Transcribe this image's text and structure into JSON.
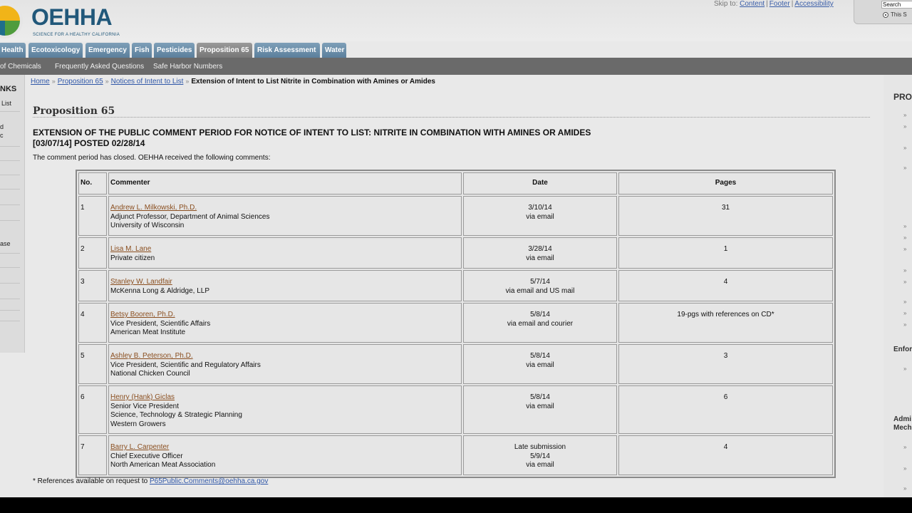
{
  "header": {
    "logo_text": "OEHHA",
    "logo_tagline": "SCIENCE FOR A HEALTHY CALIFORNIA",
    "skip_label": "Skip to:",
    "skip_links": [
      "Content",
      "Footer",
      "Accessibility"
    ],
    "search_placeholder": "Search",
    "search_scope_label": "This S"
  },
  "nav": {
    "tabs": [
      "Health",
      "Ecotoxicology",
      "Emergency",
      "Fish",
      "Pesticides",
      "Proposition 65",
      "Risk Assessment",
      "Water"
    ],
    "active_tab": "Proposition 65",
    "subnav": [
      "of Chemicals",
      "Frequently Asked Questions",
      "Safe Harbor Numbers"
    ]
  },
  "left_sidebar": {
    "title": "NKS",
    "items": [
      "List",
      "d",
      "c",
      "ase"
    ]
  },
  "right_sidebar": {
    "title": "PRO",
    "headings": [
      "Enfor",
      "Admi",
      "Mech"
    ]
  },
  "breadcrumb": {
    "links": [
      "Home",
      "Proposition 65",
      "Notices of Intent to List"
    ],
    "current": "Extension of Intent to List Nitrite in Combination with Amines or Amides"
  },
  "main": {
    "page_title": "Proposition 65",
    "heading_line1": "EXTENSION OF THE PUBLIC COMMENT PERIOD FOR NOTICE OF INTENT TO LIST: NITRITE IN COMBINATION WITH AMINES OR AMIDES",
    "heading_line2": "[03/07/14] POSTED 02/28/14",
    "intro": "The comment period has closed. OEHHA received the following comments:",
    "table": {
      "headers": [
        "No.",
        "Commenter",
        "Date",
        "Pages"
      ],
      "rows": [
        {
          "no": "1",
          "name": "Andrew L. Milkowski, Ph.D.",
          "details": [
            "Adjunct Professor, Department of Animal Sciences",
            "University of Wisconsin"
          ],
          "date": [
            "3/10/14",
            "via email"
          ],
          "pages": "31"
        },
        {
          "no": "2",
          "name": "Lisa M. Lane",
          "details": [
            "Private citizen"
          ],
          "date": [
            "3/28/14",
            "via email"
          ],
          "pages": "1"
        },
        {
          "no": "3",
          "name": "Stanley W. Landfair",
          "details": [
            "McKenna Long & Aldridge, LLP"
          ],
          "date": [
            "5/7/14",
            "via email and US mail"
          ],
          "pages": "4"
        },
        {
          "no": "4",
          "name": "Betsy Booren, Ph.D.",
          "details": [
            "Vice President, Scientific Affairs",
            "American Meat Institute"
          ],
          "date": [
            "5/8/14",
            "via email and courier"
          ],
          "pages": "19-pgs with references on CD*"
        },
        {
          "no": "5",
          "name": "Ashley B. Peterson, Ph.D.",
          "details": [
            "Vice President, Scientific and Regulatory Affairs",
            "National Chicken Council"
          ],
          "date": [
            "5/8/14",
            "via email"
          ],
          "pages": "3"
        },
        {
          "no": "6",
          "name": "Henry (Hank) Giclas",
          "details": [
            "Senior Vice President",
            "Science, Technology & Strategic Planning",
            "Western Growers"
          ],
          "date": [
            "5/8/14",
            "via email"
          ],
          "pages": "6"
        },
        {
          "no": "7",
          "name": "Barry L. Carpenter",
          "details": [
            "Chief Executive Officer",
            "North American Meat Association"
          ],
          "date": [
            "Late submission",
            "5/9/14",
            "via email"
          ],
          "pages": "4"
        }
      ]
    },
    "footnote_text": "* References available on request to ",
    "footnote_email": "P65Public.Comments@oehha.ca.gov"
  }
}
